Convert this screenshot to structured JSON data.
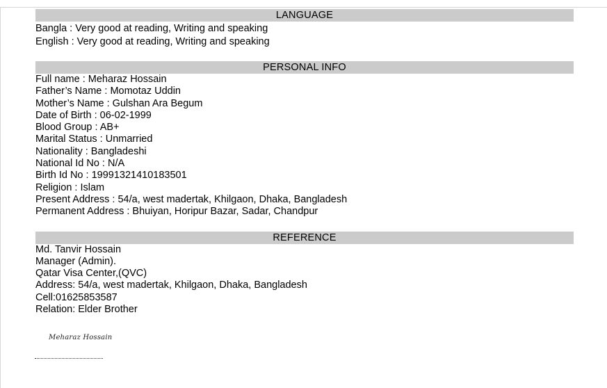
{
  "language": {
    "heading": "LANGUAGE",
    "lines": [
      "Bangla : Very good at reading, Writing and speaking",
      "English : Very good at reading, Writing and speaking"
    ]
  },
  "personal_info": {
    "heading": "PERSONAL INFO",
    "lines": [
      "Full name : Meharaz Hossain",
      "Father’s Name : Momotaz Uddin",
      "Mother’s Name : Gulshan Ara Begum",
      "Date of Birth : 06-02-1999",
      "Blood Group : AB+",
      "Marital Status : Unmarried",
      "Nationality : Bangladeshi",
      "National Id No : N/A",
      "Birth Id No : 19991321410183501",
      "Religion : Islam",
      "Present Address : 54/a, west madertak, Khilgaon, Dhaka, Bangladesh",
      "Permanent Address : Bhuiyan, Horipur Bazar, Sadar, Chandpur"
    ]
  },
  "reference": {
    "heading": "REFERENCE",
    "lines": [
      "Md. Tanvir Hossain",
      "Manager (Admin).",
      "Qatar Visa Center,(QVC)",
      "Address: 54/a, west madertak, Khilgaon, Dhaka, Bangladesh",
      "Cell:01625853587",
      "Relation: Elder Brother"
    ]
  },
  "signature": {
    "text": "Meharaz Hossain"
  }
}
